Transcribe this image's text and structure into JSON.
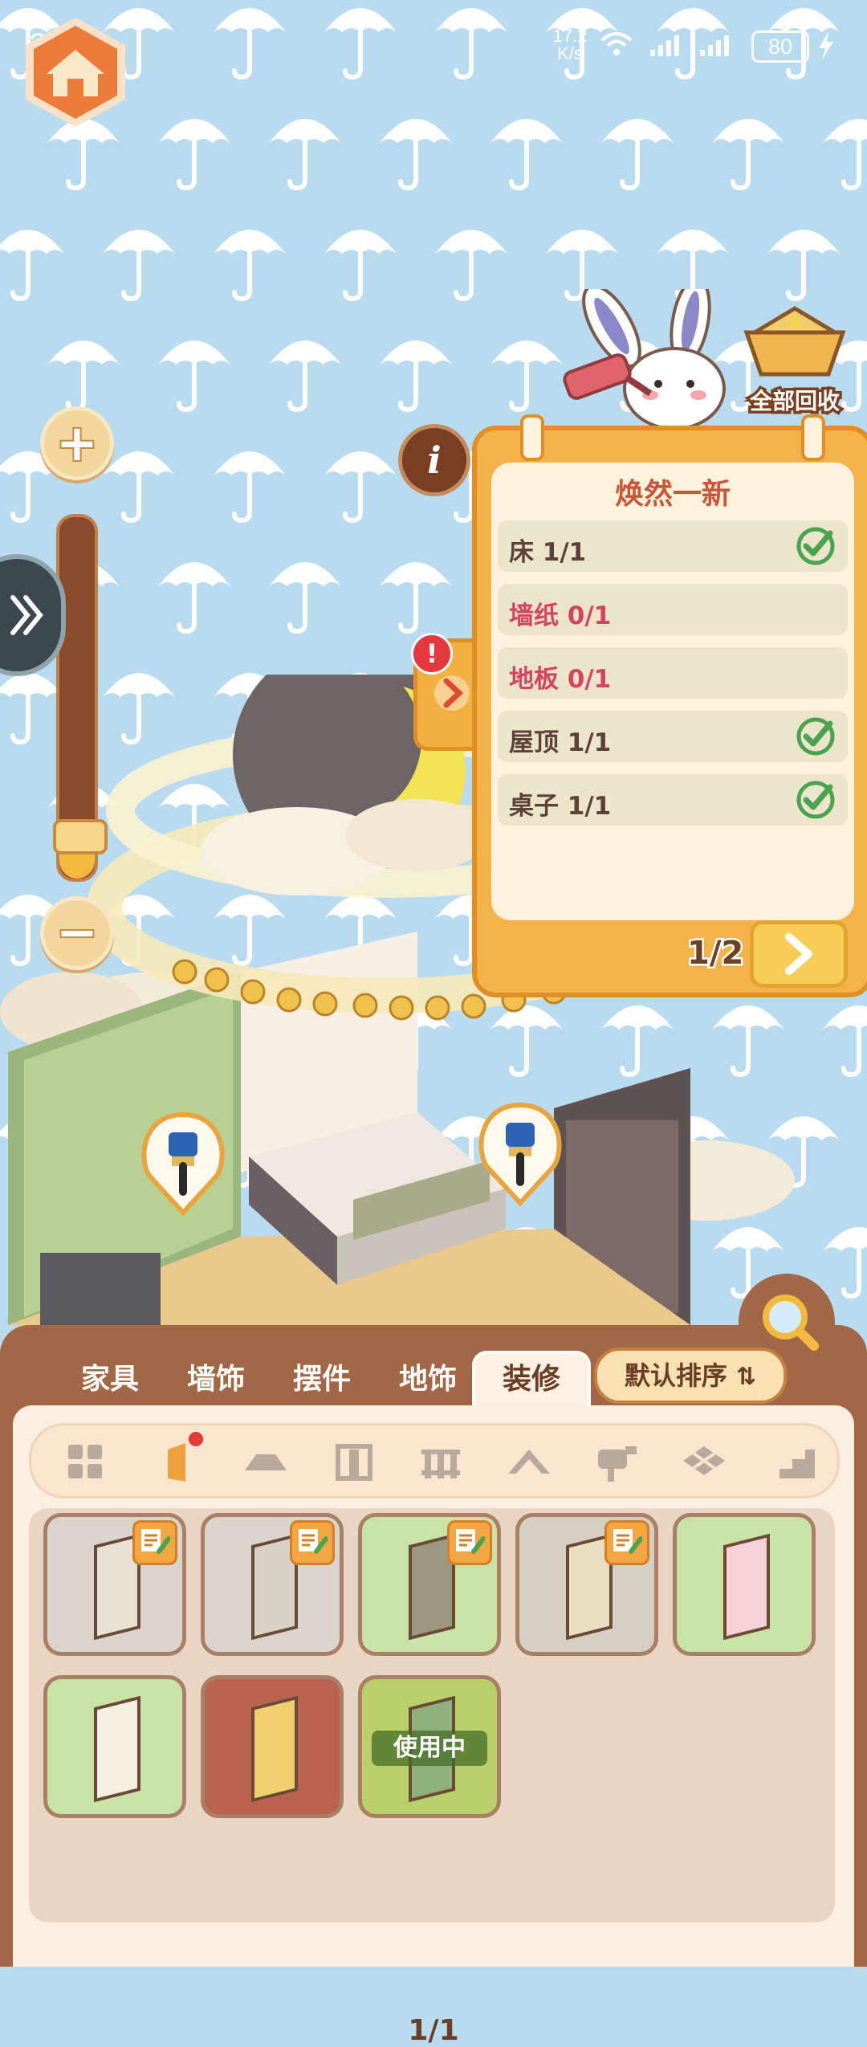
{
  "status_bar": {
    "time": "23:06",
    "net_speed_value": "17.2",
    "net_speed_unit": "K/s",
    "battery": "80"
  },
  "controls": {
    "zoom_in": "+",
    "zoom_out": "−",
    "info": "i",
    "zoom_level": 0.12
  },
  "recycle": {
    "label": "全部回收"
  },
  "task_panel": {
    "title": "焕然一新",
    "alert": "!",
    "rows": [
      {
        "label": "床 1/1",
        "done": true
      },
      {
        "label": "墙纸 0/1",
        "done": false
      },
      {
        "label": "地板 0/1",
        "done": false
      },
      {
        "label": "屋顶 1/1",
        "done": true
      },
      {
        "label": "桌子 1/1",
        "done": true
      }
    ],
    "page": "1/2"
  },
  "tabs": [
    {
      "label": "家具",
      "active": false
    },
    {
      "label": "墙饰",
      "active": false
    },
    {
      "label": "摆件",
      "active": false
    },
    {
      "label": "地饰",
      "active": false
    },
    {
      "label": "装修",
      "active": true
    }
  ],
  "sort": {
    "label": "默认排序"
  },
  "subcategories": [
    "all-icon",
    "wall-icon",
    "floor-icon",
    "door-icon",
    "fence-icon",
    "roof-icon",
    "mailbox-icon",
    "tile-icon",
    "stairs-icon"
  ],
  "items": [
    {
      "bg": "#d9d5cc",
      "panel": "#e8e1d3",
      "badge": true
    },
    {
      "bg": "#d9d5cc",
      "panel": "#d8d2c6",
      "badge": true
    },
    {
      "bg": "#c8e3a5",
      "panel": "#9d9680",
      "badge": true
    },
    {
      "bg": "#d5cec2",
      "panel": "#e7dfbd",
      "badge": true
    },
    {
      "bg": "#c8e3a5",
      "panel": "#f3d1d6",
      "badge": false
    },
    {
      "bg": "#c8e3a5",
      "panel": "#f6efe2",
      "badge": false
    },
    {
      "bg": "#b8624f",
      "panel": "#f0cf6e",
      "badge": false
    },
    {
      "bg": "#b9d068",
      "panel": "#8fb07a",
      "badge": false,
      "in_use": "使用中"
    }
  ],
  "page_indicator": "1/1",
  "colors": {
    "sky": "#b9dbef",
    "panel_brown": "#a26745",
    "task_orange": "#f4b34a",
    "check_green": "#4aa44f",
    "missing_red": "#d4445d"
  }
}
